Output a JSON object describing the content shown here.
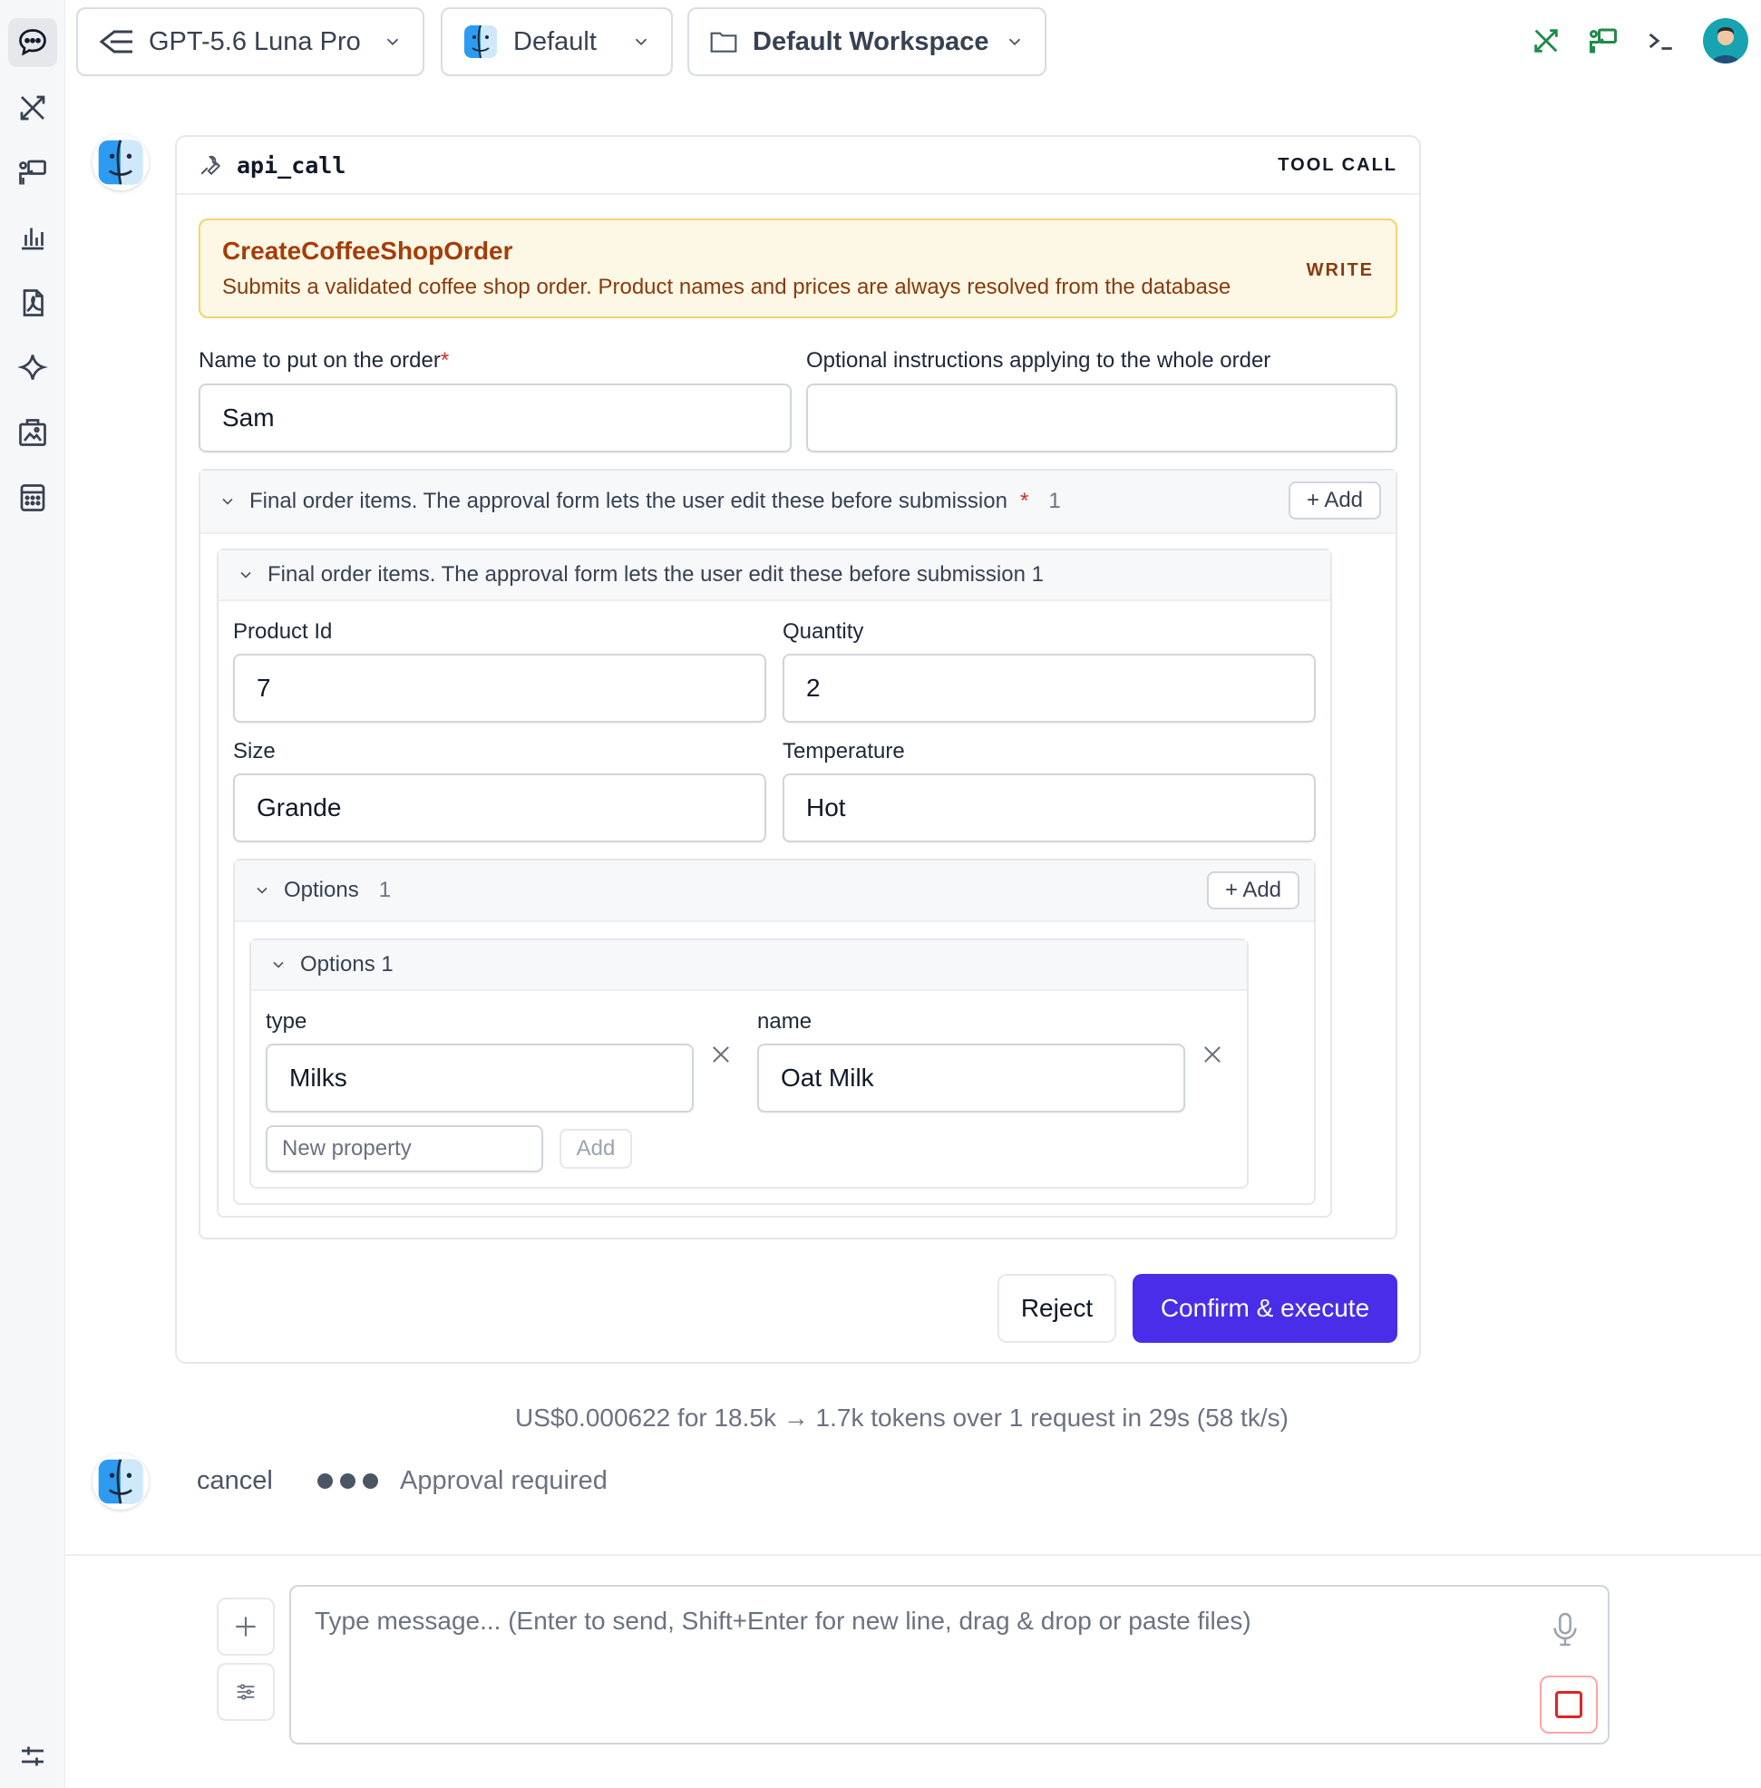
{
  "topbar": {
    "model": "GPT-5.6 Luna Pro",
    "profile": "Default",
    "workspace": "Default Workspace"
  },
  "sidebar": {
    "icons": [
      "chat-icon",
      "tools-icon",
      "presentation-icon",
      "bar-chart-icon",
      "pdf-icon",
      "sparkle-icon",
      "gallery-icon",
      "calculator-icon",
      "settings-sliders-icon"
    ]
  },
  "tool_call": {
    "name": "api_call",
    "kind": "TOOL CALL",
    "operation": {
      "title": "CreateCoffeeShopOrder",
      "description": "Submits a validated coffee shop order. Product names and prices are always resolved from the database",
      "mode": "WRITE"
    },
    "fields": {
      "order_name_label": "Name to put on the order",
      "order_name_value": "Sam",
      "instructions_label": "Optional instructions applying to the whole order",
      "instructions_value": ""
    },
    "items_group": {
      "label": "Final order items. The approval form lets the user edit these before submission",
      "required_mark": "*",
      "count": "1",
      "add_label": "+ Add",
      "item": {
        "label": "Final order items. The approval form lets the user edit these before submission 1",
        "product_id_label": "Product Id",
        "product_id_value": "7",
        "quantity_label": "Quantity",
        "quantity_value": "2",
        "size_label": "Size",
        "size_value": "Grande",
        "temperature_label": "Temperature",
        "temperature_value": "Hot",
        "options_group": {
          "label": "Options",
          "count": "1",
          "add_label": "+ Add",
          "option": {
            "label": "Options 1",
            "type_label": "type",
            "type_value": "Milks",
            "name_label": "name",
            "name_value": "Oat Milk",
            "new_property_placeholder": "New property",
            "add_property_label": "Add"
          }
        }
      }
    },
    "actions": {
      "reject": "Reject",
      "confirm": "Confirm & execute"
    }
  },
  "usage_text": "US$0.000622 for 18.5k → 1.7k tokens over 1 request in 29s (58 tk/s)",
  "status": {
    "cancel": "cancel",
    "message": "Approval required"
  },
  "composer": {
    "placeholder": "Type message... (Enter to send, Shift+Enter for new line, drag & drop or paste files)"
  },
  "colors": {
    "accent": "#4a2de8",
    "banner_bg": "#fdf8e6",
    "banner_border": "#f5d36b",
    "banner_text": "#a43d0a",
    "tool_green": "#1f8a4c"
  }
}
